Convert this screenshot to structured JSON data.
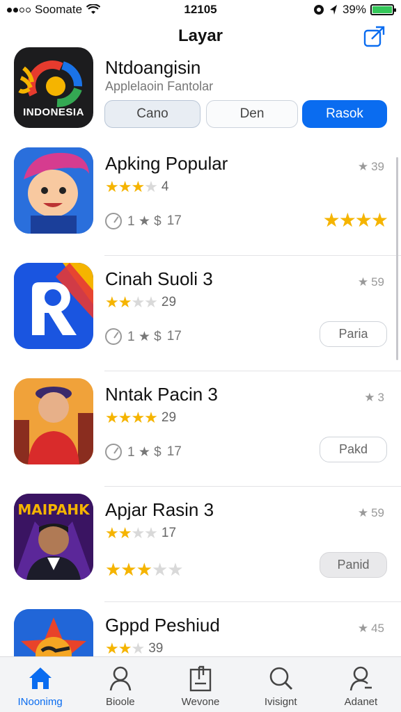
{
  "status_bar": {
    "carrier": "Soomate",
    "time": "12105",
    "battery_percent": "39%"
  },
  "header": {
    "title": "Layar"
  },
  "featured": {
    "icon_label": "INDONESIA",
    "title": "Ntdoangisin",
    "subtitle": "Applelaoin Fantolar",
    "segments": [
      "Cano",
      "Den",
      "Rasok"
    ],
    "active_segment": "Rasok"
  },
  "apps": [
    {
      "title": "Apking Popular",
      "stars_text": "4",
      "stars_filled": 3,
      "meta": "1 17",
      "meta_count": "17",
      "rating_text": "39",
      "action": "stars"
    },
    {
      "title": "Cinah Suoli 3",
      "stars_text": "29",
      "stars_filled": 2,
      "meta_count": "17",
      "rating_text": "59",
      "action_label": "Paria"
    },
    {
      "title": "Nntak Pacin 3",
      "stars_text": "29",
      "stars_filled": 4,
      "meta_count": "17",
      "rating_text": "3",
      "action_label": "Pakd"
    },
    {
      "title": "Apjar Rasin 3",
      "stars_text": "17",
      "stars_filled": 2,
      "meta_count": "",
      "rating_text": "59",
      "action_label": "Panid"
    },
    {
      "title": "Gppd Peshiud",
      "stars_text": "39",
      "stars_filled": 2,
      "meta_count": "",
      "rating_text": "45",
      "action_label": ""
    }
  ],
  "featured_icon_art_text": "MAIPAHK",
  "tabs": [
    {
      "label": "INoonimg",
      "icon": "home-icon"
    },
    {
      "label": "Bioole",
      "icon": "person-icon"
    },
    {
      "label": "Wevone",
      "icon": "bookmark-icon"
    },
    {
      "label": "Ivisignt",
      "icon": "search-icon"
    },
    {
      "label": "Adanet",
      "icon": "account-icon"
    }
  ],
  "colors": {
    "accent": "#0a6cf0",
    "star": "#f5b400",
    "battery": "#34c759"
  }
}
